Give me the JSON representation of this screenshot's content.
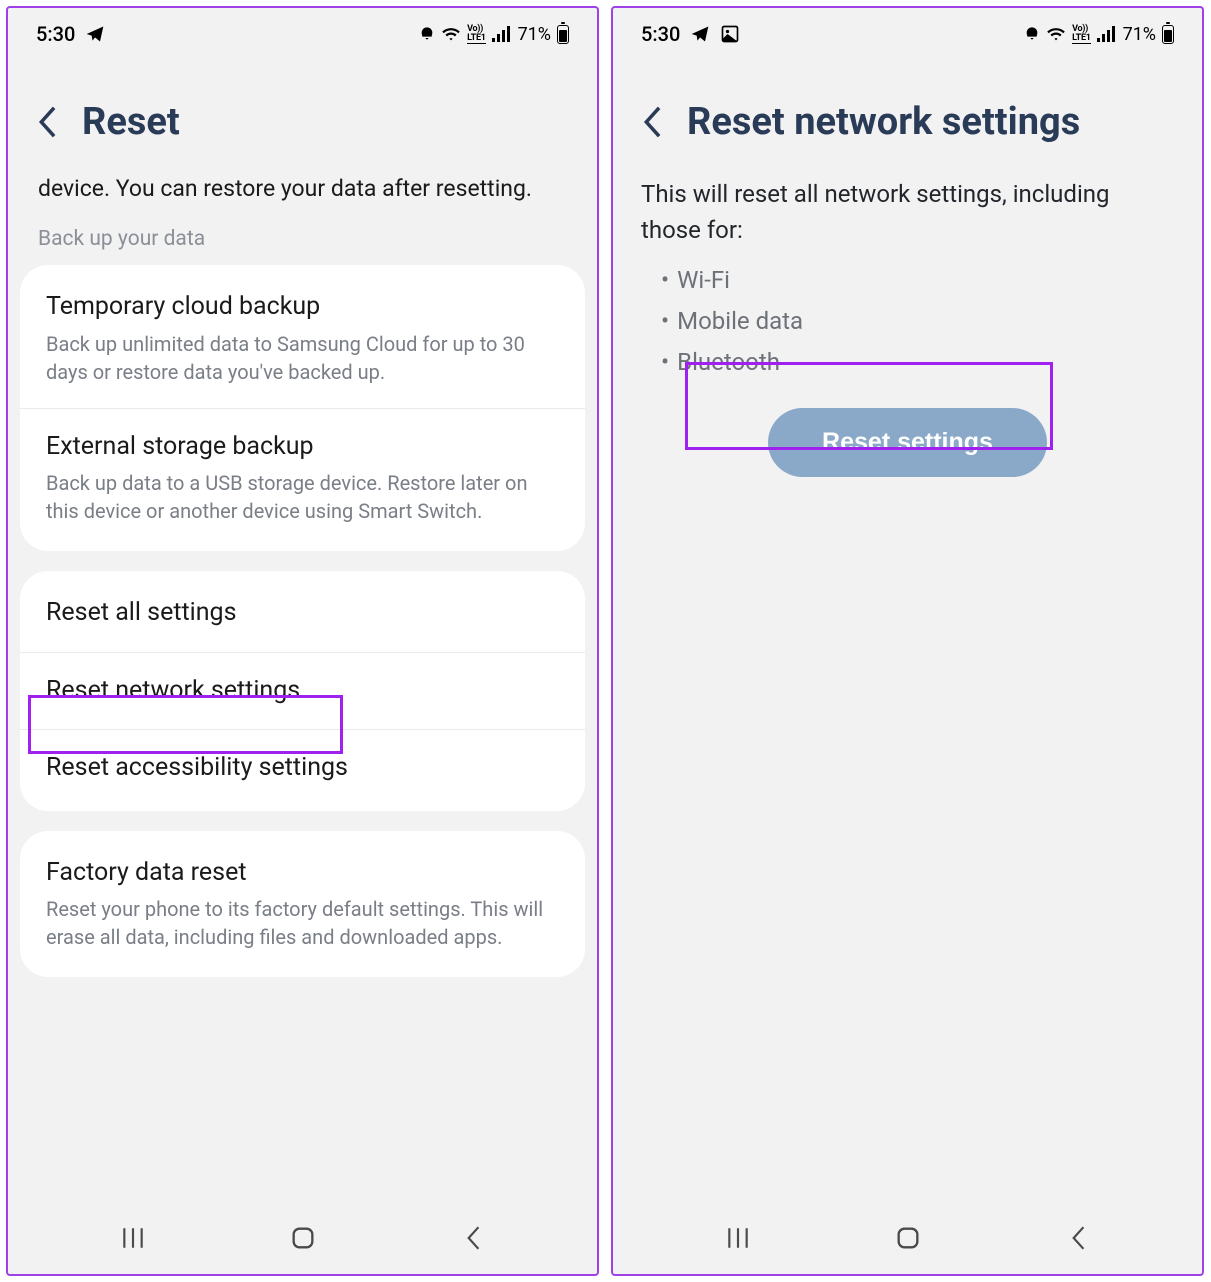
{
  "statusbar": {
    "time": "5:30",
    "battery_pct": "71%",
    "volte": "Vo))\nLTE1"
  },
  "left": {
    "title": "Reset",
    "intro": "device. You can restore your data after resetting.",
    "section_label": "Back up your data",
    "backup_items": [
      {
        "title": "Temporary cloud backup",
        "sub": "Back up unlimited data to Samsung Cloud for up to 30 days or restore data you've backed up."
      },
      {
        "title": "External storage backup",
        "sub": "Back up data to a USB storage device. Restore later on this device or another device using Smart Switch."
      }
    ],
    "reset_items": [
      {
        "title": "Reset all settings",
        "sub": ""
      },
      {
        "title": "Reset network settings",
        "sub": ""
      },
      {
        "title": "Reset accessibility settings",
        "sub": ""
      }
    ],
    "factory_item": {
      "title": "Factory data reset",
      "sub": "Reset your phone to its factory default settings. This will erase all data, including files and downloaded apps."
    }
  },
  "right": {
    "title": "Reset network settings",
    "desc": "This will reset all network settings, including those for:",
    "bullets": [
      "Wi-Fi",
      "Mobile data",
      "Bluetooth"
    ],
    "button_label": "Reset settings"
  }
}
